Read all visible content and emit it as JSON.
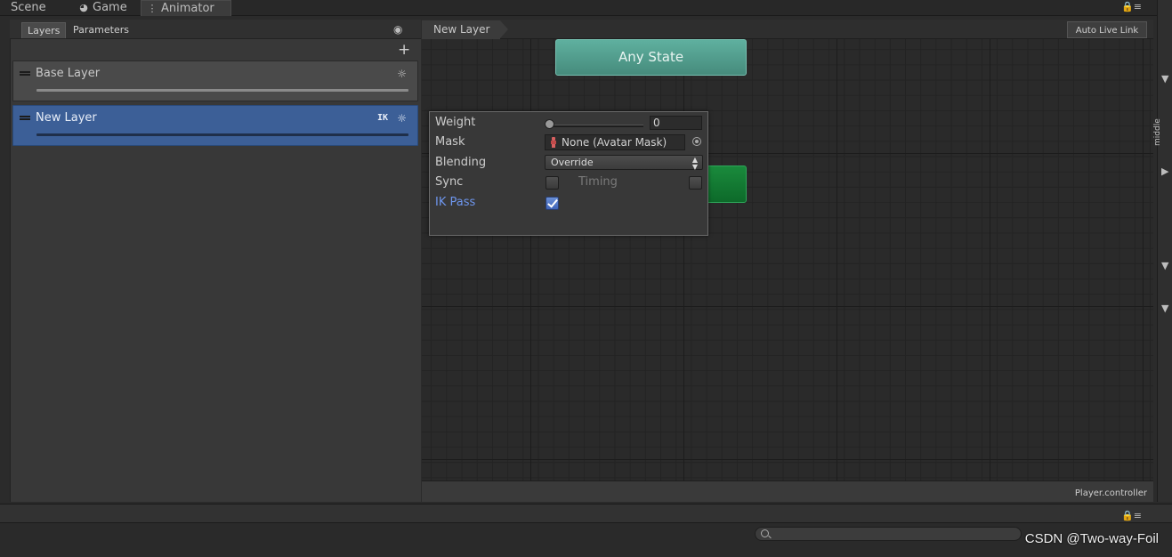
{
  "window_tabs": [
    {
      "label": "Scene",
      "icon": "scene-icon"
    },
    {
      "label": "Game",
      "icon": "pacman-icon"
    },
    {
      "label": "Animator",
      "icon": "animator-icon"
    }
  ],
  "panel_tabs": {
    "layers": "Layers",
    "parameters": "Parameters"
  },
  "layers": [
    {
      "name": "Base Layer",
      "ik": ""
    },
    {
      "name": "New Layer",
      "ik": "IK"
    }
  ],
  "graph": {
    "breadcrumb": "New Layer",
    "auto_live_link": "Auto Live Link",
    "controller_name": "Player.controller",
    "any_state_label": "Any State"
  },
  "layer_settings": {
    "weight_label": "Weight",
    "weight_value": "0",
    "weight_slider_fraction": 0,
    "mask_label": "Mask",
    "mask_value": "None (Avatar Mask)",
    "blending_label": "Blending",
    "blending_value": "Override",
    "sync_label": "Sync",
    "sync_checked": false,
    "timing_label": "Timing",
    "timing_checked": false,
    "ik_pass_label": "IK Pass",
    "ik_pass_checked": true
  },
  "side_label": "middle",
  "watermark": "CSDN @Two-way-Foil",
  "colors": {
    "selected_layer": "#3c5f97",
    "any_state": "#4f9d8c",
    "state_node": "#117a34",
    "ik_pass_label": "#6e96ee"
  }
}
